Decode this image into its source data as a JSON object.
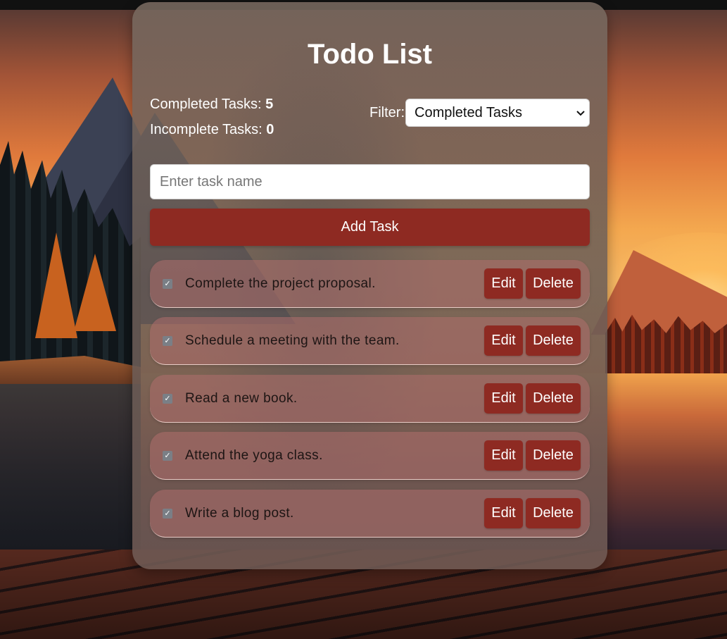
{
  "app": {
    "title": "Todo List"
  },
  "stats": {
    "completed_label": "Completed Tasks:",
    "completed_count": "5",
    "incomplete_label": "Incomplete Tasks:",
    "incomplete_count": "0"
  },
  "filter": {
    "label": "Filter:",
    "selected": "Completed Tasks"
  },
  "new_task": {
    "placeholder": "Enter task name",
    "value": "",
    "add_label": "Add Task"
  },
  "tasks": [
    {
      "text": "Complete the project proposal.",
      "checked": true,
      "edit_label": "Edit",
      "delete_label": "Delete"
    },
    {
      "text": "Schedule a meeting with the team.",
      "checked": true,
      "edit_label": "Edit",
      "delete_label": "Delete"
    },
    {
      "text": "Read a new book.",
      "checked": true,
      "edit_label": "Edit",
      "delete_label": "Delete"
    },
    {
      "text": "Attend the yoga class.",
      "checked": true,
      "edit_label": "Edit",
      "delete_label": "Delete"
    },
    {
      "text": "Write a blog post.",
      "checked": true,
      "edit_label": "Edit",
      "delete_label": "Delete"
    }
  ],
  "colors": {
    "accent": "#8e2a22",
    "title_text": "#ffffff",
    "task_text": "#1d1514"
  },
  "icons": {
    "checkbox": "checkbox-checked-icon",
    "select_arrow": "chevron-down-icon"
  }
}
